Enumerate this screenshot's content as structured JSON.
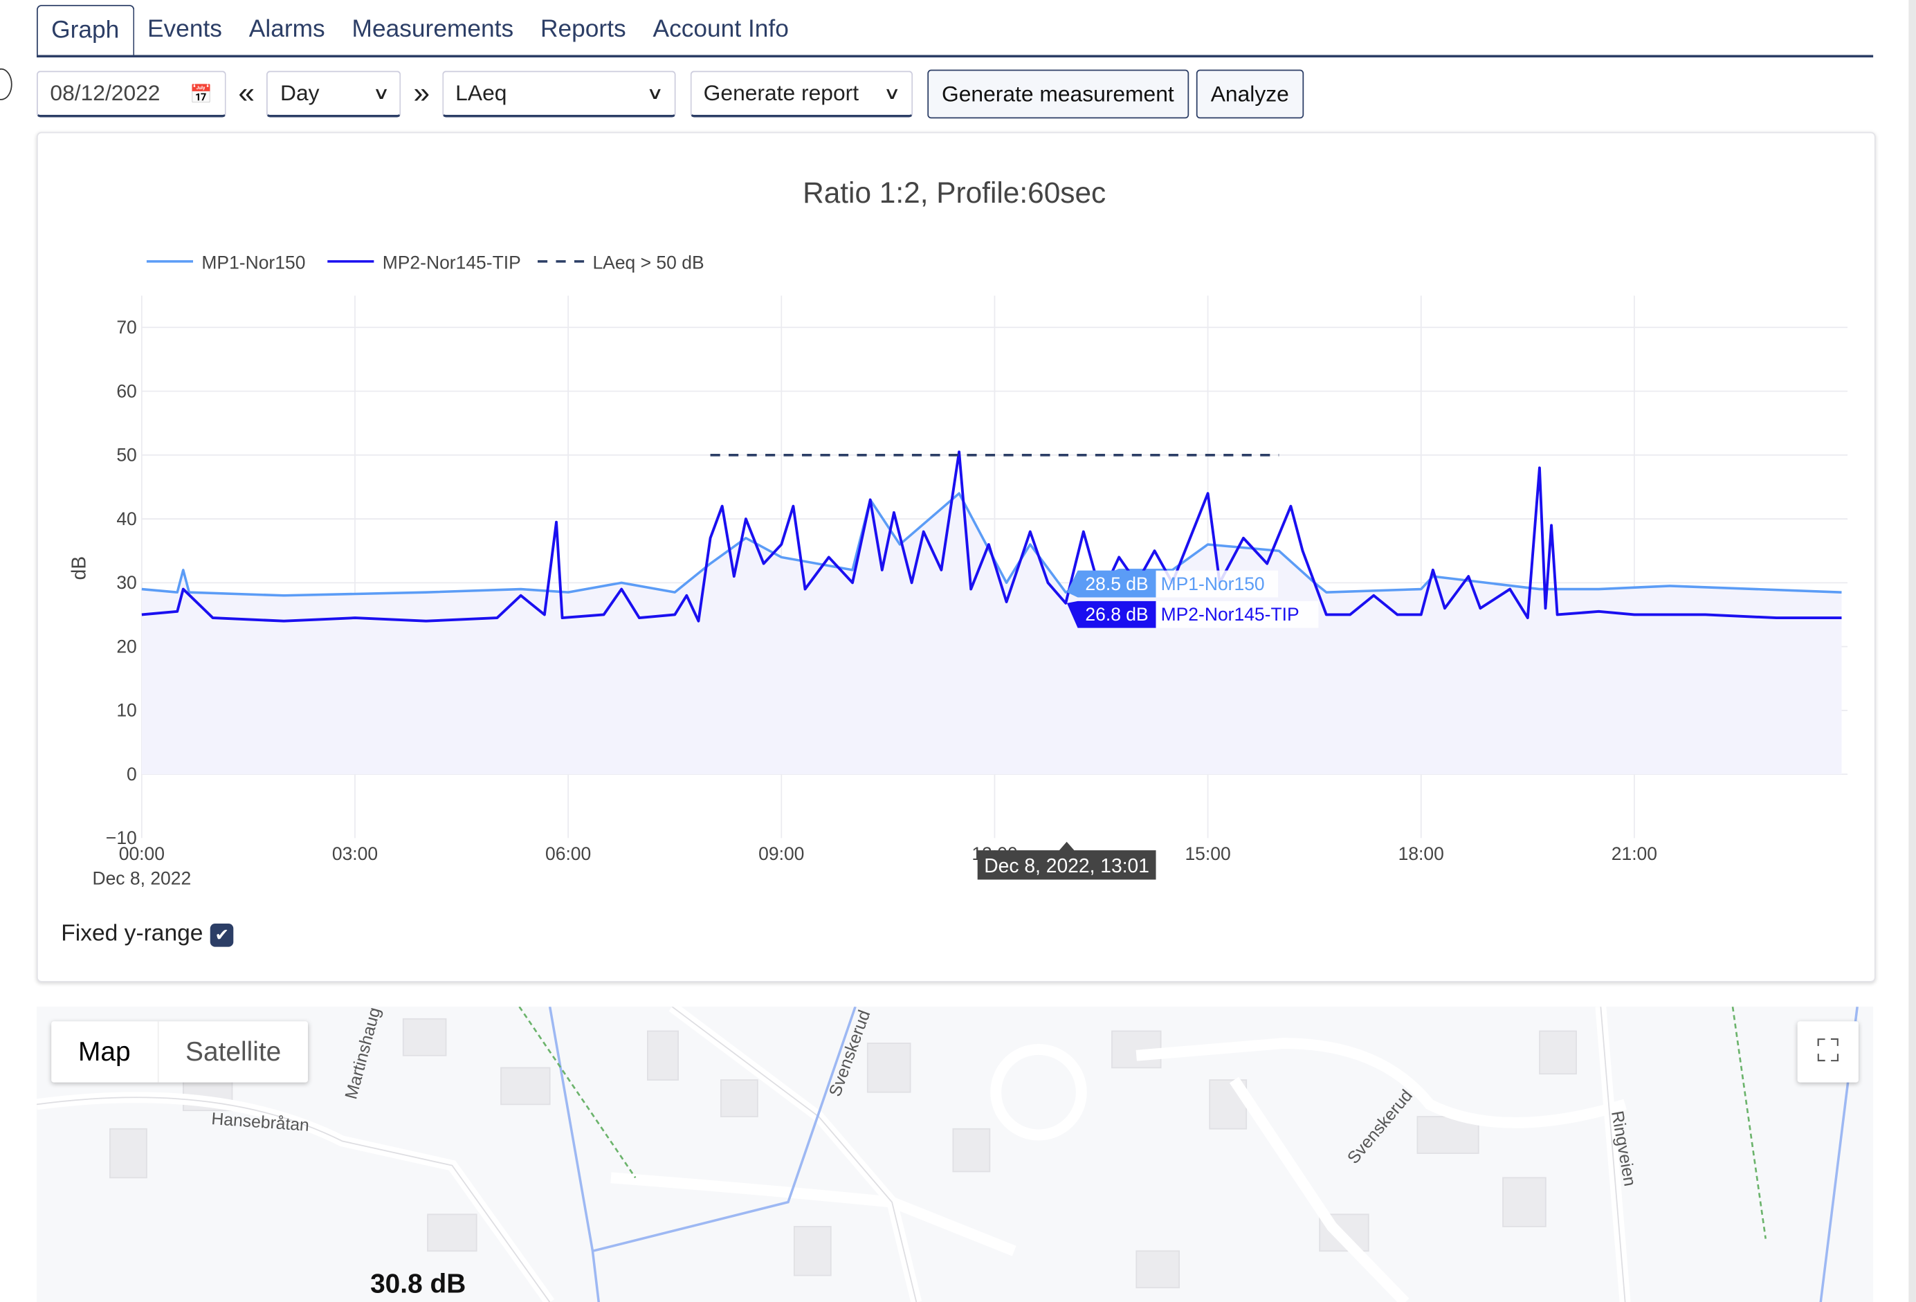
{
  "tabs": [
    {
      "label": "Graph",
      "active": true
    },
    {
      "label": "Events"
    },
    {
      "label": "Alarms"
    },
    {
      "label": "Measurements"
    },
    {
      "label": "Reports"
    },
    {
      "label": "Account Info"
    }
  ],
  "toolbar": {
    "date": "08/12/2022",
    "period": "Day",
    "metric": "LAeq",
    "report": "Generate report",
    "generate_measurement": "Generate measurement",
    "analyze": "Analyze",
    "prev_icon": "double-chevron-left",
    "next_icon": "double-chevron-right",
    "calendar_icon": "calendar"
  },
  "fixed_range": {
    "label": "Fixed y-range",
    "checked": true
  },
  "map": {
    "map_label": "Map",
    "satellite_label": "Satellite",
    "value_label": "30.8 dB",
    "streets": [
      "Hansebråtan",
      "Martinshaug",
      "Svenskerud",
      "Svenskerud",
      "Ringveien"
    ]
  },
  "hover": {
    "time": "Dec 8, 2022, 13:01",
    "mp1": "28.5 dB",
    "mp2": "26.8 dB"
  },
  "chart_data": {
    "type": "line",
    "title": "Ratio 1:2, Profile:60sec",
    "ylabel": "dB",
    "ylim": [
      -10,
      70
    ],
    "yticks": [
      "70",
      "60",
      "50",
      "40",
      "30",
      "20",
      "10",
      "0",
      "−10"
    ],
    "xticks": [
      "00:00",
      "03:00",
      "06:00",
      "09:00",
      "12:00",
      "15:00",
      "18:00",
      "21:00"
    ],
    "xdate": "Dec 8, 2022",
    "legend": "top-left",
    "grid": true,
    "series": [
      {
        "name": "MP1-Nor150",
        "color": "#5b9cf6",
        "points": [
          [
            "00:00",
            29
          ],
          [
            "00:30",
            28.5
          ],
          [
            "00:35",
            32
          ],
          [
            "00:40",
            28.5
          ],
          [
            "02:00",
            28
          ],
          [
            "04:00",
            28.5
          ],
          [
            "05:20",
            29
          ],
          [
            "06:00",
            28.5
          ],
          [
            "06:45",
            30
          ],
          [
            "07:30",
            28.5
          ],
          [
            "08:00",
            33
          ],
          [
            "08:30",
            37
          ],
          [
            "09:00",
            34
          ],
          [
            "10:00",
            32
          ],
          [
            "10:15",
            43
          ],
          [
            "10:40",
            36
          ],
          [
            "11:30",
            44
          ],
          [
            "12:10",
            30
          ],
          [
            "12:30",
            36
          ],
          [
            "13:00",
            28.5
          ],
          [
            "13:45",
            32
          ],
          [
            "14:30",
            32
          ],
          [
            "15:00",
            36
          ],
          [
            "16:00",
            35
          ],
          [
            "16:30",
            30
          ],
          [
            "16:40",
            28.5
          ],
          [
            "18:00",
            29
          ],
          [
            "18:10",
            31
          ],
          [
            "19:40",
            29
          ],
          [
            "20:30",
            29
          ],
          [
            "21:30",
            29.5
          ],
          [
            "23:55",
            28.5
          ]
        ]
      },
      {
        "name": "MP2-Nor145-TIP",
        "color": "#1a0ff0",
        "points": [
          [
            "00:00",
            25
          ],
          [
            "00:30",
            25.5
          ],
          [
            "00:35",
            29
          ],
          [
            "01:00",
            24.5
          ],
          [
            "02:00",
            24
          ],
          [
            "03:00",
            24.5
          ],
          [
            "04:00",
            24
          ],
          [
            "05:00",
            24.5
          ],
          [
            "05:20",
            28
          ],
          [
            "05:40",
            25
          ],
          [
            "05:50",
            39.5
          ],
          [
            "05:55",
            24.5
          ],
          [
            "06:30",
            25
          ],
          [
            "06:45",
            29
          ],
          [
            "07:00",
            24.5
          ],
          [
            "07:30",
            25
          ],
          [
            "07:40",
            28
          ],
          [
            "07:50",
            24
          ],
          [
            "08:00",
            37
          ],
          [
            "08:10",
            42
          ],
          [
            "08:20",
            31
          ],
          [
            "08:30",
            40
          ],
          [
            "08:45",
            33
          ],
          [
            "09:00",
            36
          ],
          [
            "09:10",
            42
          ],
          [
            "09:20",
            29
          ],
          [
            "09:40",
            34
          ],
          [
            "10:00",
            30
          ],
          [
            "10:15",
            43
          ],
          [
            "10:25",
            32
          ],
          [
            "10:35",
            41
          ],
          [
            "10:50",
            30
          ],
          [
            "11:00",
            38
          ],
          [
            "11:15",
            32
          ],
          [
            "11:30",
            50.5
          ],
          [
            "11:40",
            29
          ],
          [
            "11:55",
            36
          ],
          [
            "12:10",
            27
          ],
          [
            "12:30",
            38
          ],
          [
            "12:45",
            30
          ],
          [
            "13:00",
            26.8
          ],
          [
            "13:15",
            38
          ],
          [
            "13:30",
            28
          ],
          [
            "13:45",
            34
          ],
          [
            "14:00",
            30
          ],
          [
            "14:15",
            35
          ],
          [
            "14:30",
            30
          ],
          [
            "14:45",
            37
          ],
          [
            "15:00",
            44
          ],
          [
            "15:10",
            30
          ],
          [
            "15:30",
            37
          ],
          [
            "15:50",
            33
          ],
          [
            "16:10",
            42
          ],
          [
            "16:20",
            35
          ],
          [
            "16:30",
            30
          ],
          [
            "16:40",
            25
          ],
          [
            "17:00",
            25
          ],
          [
            "17:20",
            28
          ],
          [
            "17:40",
            25
          ],
          [
            "18:00",
            25
          ],
          [
            "18:10",
            32
          ],
          [
            "18:20",
            26
          ],
          [
            "18:40",
            31
          ],
          [
            "18:50",
            26
          ],
          [
            "19:15",
            29
          ],
          [
            "19:30",
            24.5
          ],
          [
            "19:40",
            48
          ],
          [
            "19:45",
            26
          ],
          [
            "19:50",
            39
          ],
          [
            "19:55",
            25
          ],
          [
            "20:30",
            25.5
          ],
          [
            "21:00",
            25
          ],
          [
            "22:00",
            25
          ],
          [
            "23:00",
            24.5
          ],
          [
            "23:55",
            24.5
          ]
        ]
      },
      {
        "name": "LAeq > 50 dB",
        "color": "#2c3e66",
        "dash": true,
        "points": [
          [
            "08:00",
            50
          ],
          [
            "16:00",
            50
          ]
        ]
      }
    ]
  }
}
